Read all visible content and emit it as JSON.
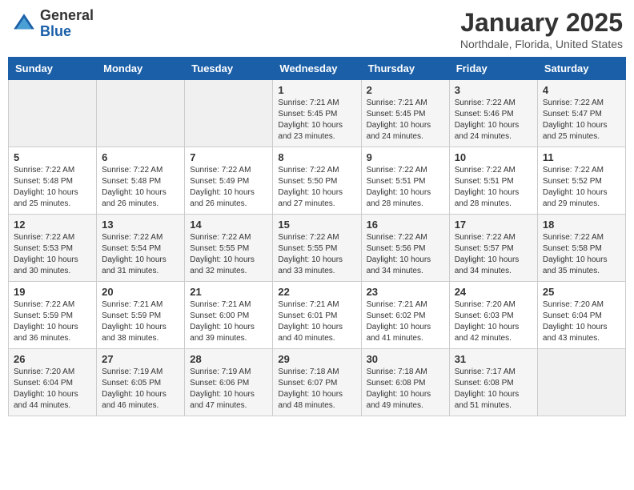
{
  "header": {
    "logo_general": "General",
    "logo_blue": "Blue",
    "title": "January 2025",
    "subtitle": "Northdale, Florida, United States"
  },
  "days_of_week": [
    "Sunday",
    "Monday",
    "Tuesday",
    "Wednesday",
    "Thursday",
    "Friday",
    "Saturday"
  ],
  "weeks": [
    [
      {
        "num": "",
        "info": ""
      },
      {
        "num": "",
        "info": ""
      },
      {
        "num": "",
        "info": ""
      },
      {
        "num": "1",
        "info": "Sunrise: 7:21 AM\nSunset: 5:45 PM\nDaylight: 10 hours\nand 23 minutes."
      },
      {
        "num": "2",
        "info": "Sunrise: 7:21 AM\nSunset: 5:45 PM\nDaylight: 10 hours\nand 24 minutes."
      },
      {
        "num": "3",
        "info": "Sunrise: 7:22 AM\nSunset: 5:46 PM\nDaylight: 10 hours\nand 24 minutes."
      },
      {
        "num": "4",
        "info": "Sunrise: 7:22 AM\nSunset: 5:47 PM\nDaylight: 10 hours\nand 25 minutes."
      }
    ],
    [
      {
        "num": "5",
        "info": "Sunrise: 7:22 AM\nSunset: 5:48 PM\nDaylight: 10 hours\nand 25 minutes."
      },
      {
        "num": "6",
        "info": "Sunrise: 7:22 AM\nSunset: 5:48 PM\nDaylight: 10 hours\nand 26 minutes."
      },
      {
        "num": "7",
        "info": "Sunrise: 7:22 AM\nSunset: 5:49 PM\nDaylight: 10 hours\nand 26 minutes."
      },
      {
        "num": "8",
        "info": "Sunrise: 7:22 AM\nSunset: 5:50 PM\nDaylight: 10 hours\nand 27 minutes."
      },
      {
        "num": "9",
        "info": "Sunrise: 7:22 AM\nSunset: 5:51 PM\nDaylight: 10 hours\nand 28 minutes."
      },
      {
        "num": "10",
        "info": "Sunrise: 7:22 AM\nSunset: 5:51 PM\nDaylight: 10 hours\nand 28 minutes."
      },
      {
        "num": "11",
        "info": "Sunrise: 7:22 AM\nSunset: 5:52 PM\nDaylight: 10 hours\nand 29 minutes."
      }
    ],
    [
      {
        "num": "12",
        "info": "Sunrise: 7:22 AM\nSunset: 5:53 PM\nDaylight: 10 hours\nand 30 minutes."
      },
      {
        "num": "13",
        "info": "Sunrise: 7:22 AM\nSunset: 5:54 PM\nDaylight: 10 hours\nand 31 minutes."
      },
      {
        "num": "14",
        "info": "Sunrise: 7:22 AM\nSunset: 5:55 PM\nDaylight: 10 hours\nand 32 minutes."
      },
      {
        "num": "15",
        "info": "Sunrise: 7:22 AM\nSunset: 5:55 PM\nDaylight: 10 hours\nand 33 minutes."
      },
      {
        "num": "16",
        "info": "Sunrise: 7:22 AM\nSunset: 5:56 PM\nDaylight: 10 hours\nand 34 minutes."
      },
      {
        "num": "17",
        "info": "Sunrise: 7:22 AM\nSunset: 5:57 PM\nDaylight: 10 hours\nand 34 minutes."
      },
      {
        "num": "18",
        "info": "Sunrise: 7:22 AM\nSunset: 5:58 PM\nDaylight: 10 hours\nand 35 minutes."
      }
    ],
    [
      {
        "num": "19",
        "info": "Sunrise: 7:22 AM\nSunset: 5:59 PM\nDaylight: 10 hours\nand 36 minutes."
      },
      {
        "num": "20",
        "info": "Sunrise: 7:21 AM\nSunset: 5:59 PM\nDaylight: 10 hours\nand 38 minutes."
      },
      {
        "num": "21",
        "info": "Sunrise: 7:21 AM\nSunset: 6:00 PM\nDaylight: 10 hours\nand 39 minutes."
      },
      {
        "num": "22",
        "info": "Sunrise: 7:21 AM\nSunset: 6:01 PM\nDaylight: 10 hours\nand 40 minutes."
      },
      {
        "num": "23",
        "info": "Sunrise: 7:21 AM\nSunset: 6:02 PM\nDaylight: 10 hours\nand 41 minutes."
      },
      {
        "num": "24",
        "info": "Sunrise: 7:20 AM\nSunset: 6:03 PM\nDaylight: 10 hours\nand 42 minutes."
      },
      {
        "num": "25",
        "info": "Sunrise: 7:20 AM\nSunset: 6:04 PM\nDaylight: 10 hours\nand 43 minutes."
      }
    ],
    [
      {
        "num": "26",
        "info": "Sunrise: 7:20 AM\nSunset: 6:04 PM\nDaylight: 10 hours\nand 44 minutes."
      },
      {
        "num": "27",
        "info": "Sunrise: 7:19 AM\nSunset: 6:05 PM\nDaylight: 10 hours\nand 46 minutes."
      },
      {
        "num": "28",
        "info": "Sunrise: 7:19 AM\nSunset: 6:06 PM\nDaylight: 10 hours\nand 47 minutes."
      },
      {
        "num": "29",
        "info": "Sunrise: 7:18 AM\nSunset: 6:07 PM\nDaylight: 10 hours\nand 48 minutes."
      },
      {
        "num": "30",
        "info": "Sunrise: 7:18 AM\nSunset: 6:08 PM\nDaylight: 10 hours\nand 49 minutes."
      },
      {
        "num": "31",
        "info": "Sunrise: 7:17 AM\nSunset: 6:08 PM\nDaylight: 10 hours\nand 51 minutes."
      },
      {
        "num": "",
        "info": ""
      }
    ]
  ]
}
